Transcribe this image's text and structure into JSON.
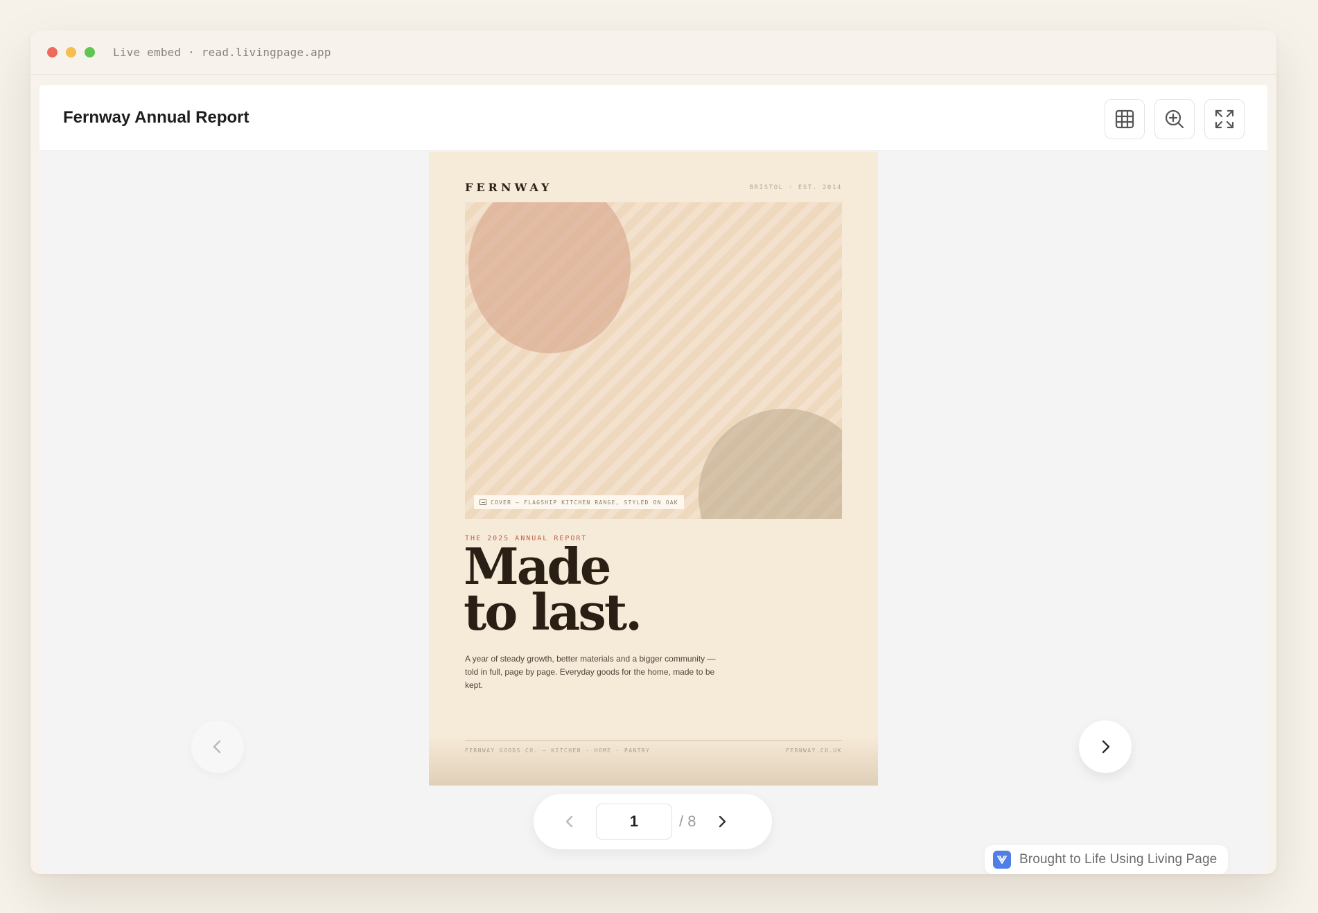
{
  "window": {
    "url_text": "Live embed · read.livingpage.app"
  },
  "header": {
    "title": "Fernway Annual Report",
    "tools": [
      {
        "name": "grid-view-icon"
      },
      {
        "name": "zoom-in-icon"
      },
      {
        "name": "fullscreen-icon"
      }
    ]
  },
  "page": {
    "brand": "FERNWAY",
    "brand_meta": "BRISTOL · EST. 2014",
    "cover_caption": "COVER — FLAGSHIP KITCHEN RANGE, STYLED ON OAK",
    "kicker": "THE 2025 ANNUAL REPORT",
    "headline_line1": "Made",
    "headline_line2": "to last.",
    "blurb": "A year of steady growth, better materials and a bigger community — told in full, page by page. Everyday goods for the home, made to be kept.",
    "footer_left": "FERNWAY GOODS CO. — KITCHEN · HOME · PANTRY",
    "footer_right": "FERNWAY.CO.UK"
  },
  "pager": {
    "current": "1",
    "total": "/ 8"
  },
  "badge": {
    "label": "Brought to Life Using Living Page",
    "icon": "living-page-logo-icon"
  },
  "colors": {
    "page_background": "#f6ead8",
    "kicker": "#c0604a",
    "badge_icon": "#4f7fe6",
    "dot_red": "#ec6a5e",
    "dot_yellow": "#f4bf4f",
    "dot_green": "#61c554"
  }
}
